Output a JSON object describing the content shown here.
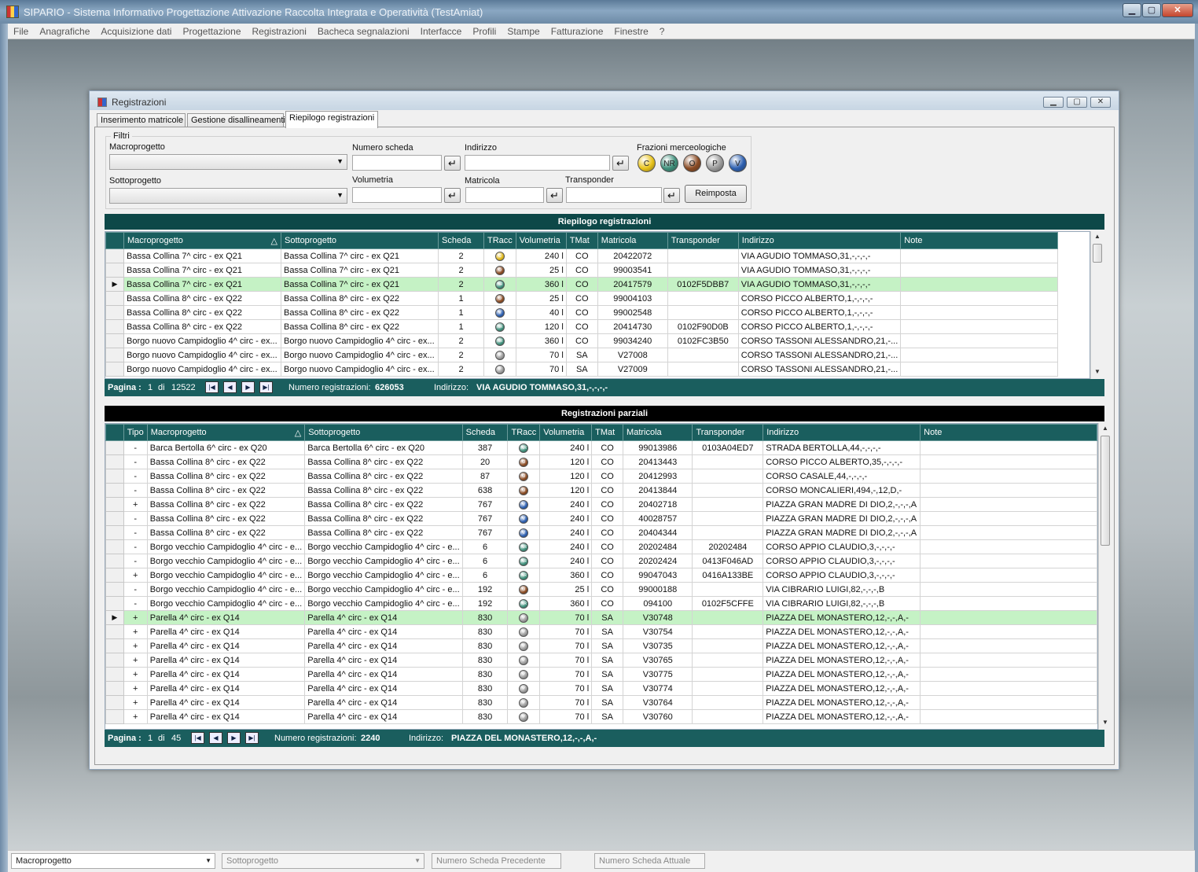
{
  "app": {
    "title": "SIPARIO - Sistema Informativo Progettazione Attivazione Raccolta Integrata e Operatività (TestAmiat)",
    "window_buttons": [
      "▁",
      "▢",
      "✕"
    ]
  },
  "menu": [
    "File",
    "Anagrafiche",
    "Acquisizione dati",
    "Progettazione",
    "Registrazioni",
    "Bacheca segnalazioni",
    "Interfacce",
    "Profili",
    "Stampe",
    "Fatturazione",
    "Finestre",
    "?"
  ],
  "child": {
    "title": "Registrazioni",
    "tabs": [
      "Inserimento matricole",
      "Gestione disallineamenti",
      "Riepilogo registrazioni"
    ],
    "active_tab": 2
  },
  "filters": {
    "legend": "Filtri",
    "macroprogetto_label": "Macroprogetto",
    "sottoprogetto_label": "Sottoprogetto",
    "numero_scheda_label": "Numero scheda",
    "volumetria_label": "Volumetria",
    "indirizzo_label": "Indirizzo",
    "matricola_label": "Matricola",
    "transponder_label": "Transponder",
    "frazioni_label": "Frazioni merceologiche",
    "frazioni": [
      {
        "code": "C",
        "color": "#e8c31a"
      },
      {
        "code": "NR",
        "color": "#3e8f7a"
      },
      {
        "code": "O",
        "color": "#8a4a22"
      },
      {
        "code": "P",
        "color": "#9a9a9a"
      },
      {
        "code": "V",
        "color": "#2c5fb0"
      }
    ],
    "reset_label": "Reimposta",
    "enter_glyph": "↵"
  },
  "frac_colors": {
    "C": "#e0b81a",
    "NR": "#3e8f7a",
    "O": "#8a4a22",
    "P": "#9a9a9a",
    "V": "#2c5fb0"
  },
  "grid1": {
    "title": "Riepilogo registrazioni",
    "title_bg": "#0d4848",
    "columns": [
      "Macroprogetto",
      "Sottoprogetto",
      "Scheda",
      "TRacc",
      "Volumetria",
      "TMat",
      "Matricola",
      "Transponder",
      "Indirizzo",
      "Note"
    ],
    "sort_glyph": "△",
    "rows": [
      {
        "macro": "Bassa Collina 7^ circ - ex Q21",
        "sotto": "Bassa Collina 7^ circ - ex Q21",
        "scheda": "2",
        "tracc": "C",
        "vol": "240 l",
        "tmat": "CO",
        "matricola": "20422072",
        "transponder": "",
        "indirizzo": "VIA AGUDIO TOMMASO,31,-,-,-,-",
        "note": ""
      },
      {
        "macro": "Bassa Collina 7^ circ - ex Q21",
        "sotto": "Bassa Collina 7^ circ - ex Q21",
        "scheda": "2",
        "tracc": "O",
        "vol": "25 l",
        "tmat": "CO",
        "matricola": "99003541",
        "transponder": "",
        "indirizzo": "VIA AGUDIO TOMMASO,31,-,-,-,-",
        "note": ""
      },
      {
        "macro": "Bassa Collina 7^ circ - ex Q21",
        "sotto": "Bassa Collina 7^ circ - ex Q21",
        "scheda": "2",
        "tracc": "NR",
        "vol": "360 l",
        "tmat": "CO",
        "matricola": "20417579",
        "transponder": "0102F5DBB7",
        "indirizzo": "VIA AGUDIO TOMMASO,31,-,-,-,-",
        "note": "",
        "selected": true
      },
      {
        "macro": "Bassa Collina 8^ circ - ex Q22",
        "sotto": "Bassa Collina 8^ circ - ex Q22",
        "scheda": "1",
        "tracc": "O",
        "vol": "25 l",
        "tmat": "CO",
        "matricola": "99004103",
        "transponder": "",
        "indirizzo": "CORSO PICCO ALBERTO,1,-,-,-,-",
        "note": ""
      },
      {
        "macro": "Bassa Collina 8^ circ - ex Q22",
        "sotto": "Bassa Collina 8^ circ - ex Q22",
        "scheda": "1",
        "tracc": "V",
        "vol": "40 l",
        "tmat": "CO",
        "matricola": "99002548",
        "transponder": "",
        "indirizzo": "CORSO PICCO ALBERTO,1,-,-,-,-",
        "note": ""
      },
      {
        "macro": "Bassa Collina 8^ circ - ex Q22",
        "sotto": "Bassa Collina 8^ circ - ex Q22",
        "scheda": "1",
        "tracc": "NR",
        "vol": "120 l",
        "tmat": "CO",
        "matricola": "20414730",
        "transponder": "0102F90D0B",
        "indirizzo": "CORSO PICCO ALBERTO,1,-,-,-,-",
        "note": ""
      },
      {
        "macro": "Borgo nuovo Campidoglio 4^ circ - ex...",
        "sotto": "Borgo nuovo Campidoglio 4^ circ - ex...",
        "scheda": "2",
        "tracc": "NR",
        "vol": "360 l",
        "tmat": "CO",
        "matricola": "99034240",
        "transponder": "0102FC3B50",
        "indirizzo": "CORSO TASSONI ALESSANDRO,21,-...",
        "note": ""
      },
      {
        "macro": "Borgo nuovo Campidoglio 4^ circ - ex...",
        "sotto": "Borgo nuovo Campidoglio 4^ circ - ex...",
        "scheda": "2",
        "tracc": "P",
        "vol": "70 l",
        "tmat": "SA",
        "matricola": "V27008",
        "transponder": "",
        "indirizzo": "CORSO TASSONI ALESSANDRO,21,-...",
        "note": ""
      },
      {
        "macro": "Borgo nuovo Campidoglio 4^ circ - ex...",
        "sotto": "Borgo nuovo Campidoglio 4^ circ - ex...",
        "scheda": "2",
        "tracc": "P",
        "vol": "70 l",
        "tmat": "SA",
        "matricola": "V27009",
        "transponder": "",
        "indirizzo": "CORSO TASSONI ALESSANDRO,21,-...",
        "note": ""
      }
    ],
    "pager": {
      "pagina_label": "Pagina :",
      "page": "1",
      "di": "di",
      "total_pages": "12522",
      "numreg_label": "Numero registrazioni:",
      "numreg": "626053",
      "indirizzo_label": "Indirizzo:",
      "indirizzo": "VIA AGUDIO TOMMASO,31,-,-,-,-"
    }
  },
  "grid2": {
    "title": "Registrazioni parziali",
    "title_bg": "#000000",
    "columns": [
      "Tipo",
      "Macroprogetto",
      "Sottoprogetto",
      "Scheda",
      "TRacc",
      "Volumetria",
      "TMat",
      "Matricola",
      "Transponder",
      "Indirizzo",
      "Note"
    ],
    "sort_glyph": "△",
    "rows": [
      {
        "tipo": "-",
        "macro": "Barca Bertolla 6^ circ - ex Q20",
        "sotto": "Barca Bertolla 6^ circ - ex Q20",
        "scheda": "387",
        "tracc": "NR",
        "vol": "240 l",
        "tmat": "CO",
        "matricola": "99013986",
        "transponder": "0103A04ED7",
        "indirizzo": "STRADA BERTOLLA,44,-,-,-,-",
        "note": ""
      },
      {
        "tipo": "-",
        "macro": "Bassa Collina 8^ circ - ex Q22",
        "sotto": "Bassa Collina 8^ circ - ex Q22",
        "scheda": "20",
        "tracc": "O",
        "vol": "120 l",
        "tmat": "CO",
        "matricola": "20413443",
        "transponder": "",
        "indirizzo": "CORSO PICCO ALBERTO,35,-,-,-,-",
        "note": ""
      },
      {
        "tipo": "-",
        "macro": "Bassa Collina 8^ circ - ex Q22",
        "sotto": "Bassa Collina 8^ circ - ex Q22",
        "scheda": "87",
        "tracc": "O",
        "vol": "120 l",
        "tmat": "CO",
        "matricola": "20412993",
        "transponder": "",
        "indirizzo": "CORSO CASALE,44,-,-,-,-",
        "note": ""
      },
      {
        "tipo": "-",
        "macro": "Bassa Collina 8^ circ - ex Q22",
        "sotto": "Bassa Collina 8^ circ - ex Q22",
        "scheda": "638",
        "tracc": "O",
        "vol": "120 l",
        "tmat": "CO",
        "matricola": "20413844",
        "transponder": "",
        "indirizzo": "CORSO MONCALIERI,494,-,12,D,-",
        "note": ""
      },
      {
        "tipo": "+",
        "macro": "Bassa Collina 8^ circ - ex Q22",
        "sotto": "Bassa Collina 8^ circ - ex Q22",
        "scheda": "767",
        "tracc": "V",
        "vol": "240 l",
        "tmat": "CO",
        "matricola": "20402718",
        "transponder": "",
        "indirizzo": "PIAZZA GRAN MADRE DI DIO,2,-,-,-,A",
        "note": ""
      },
      {
        "tipo": "-",
        "macro": "Bassa Collina 8^ circ - ex Q22",
        "sotto": "Bassa Collina 8^ circ - ex Q22",
        "scheda": "767",
        "tracc": "V",
        "vol": "240 l",
        "tmat": "CO",
        "matricola": "40028757",
        "transponder": "",
        "indirizzo": "PIAZZA GRAN MADRE DI DIO,2,-,-,-,A",
        "note": ""
      },
      {
        "tipo": "-",
        "macro": "Bassa Collina 8^ circ - ex Q22",
        "sotto": "Bassa Collina 8^ circ - ex Q22",
        "scheda": "767",
        "tracc": "V",
        "vol": "240 l",
        "tmat": "CO",
        "matricola": "20404344",
        "transponder": "",
        "indirizzo": "PIAZZA GRAN MADRE DI DIO,2,-,-,-,A",
        "note": ""
      },
      {
        "tipo": "-",
        "macro": "Borgo vecchio Campidoglio 4^ circ - e...",
        "sotto": "Borgo vecchio Campidoglio 4^ circ - e...",
        "scheda": "6",
        "tracc": "NR",
        "vol": "240 l",
        "tmat": "CO",
        "matricola": "20202484",
        "transponder": "20202484",
        "indirizzo": "CORSO APPIO CLAUDIO,3,-,-,-,-",
        "note": ""
      },
      {
        "tipo": "-",
        "macro": "Borgo vecchio Campidoglio 4^ circ - e...",
        "sotto": "Borgo vecchio Campidoglio 4^ circ - e...",
        "scheda": "6",
        "tracc": "NR",
        "vol": "240 l",
        "tmat": "CO",
        "matricola": "20202424",
        "transponder": "0413F046AD",
        "indirizzo": "CORSO APPIO CLAUDIO,3,-,-,-,-",
        "note": ""
      },
      {
        "tipo": "+",
        "macro": "Borgo vecchio Campidoglio 4^ circ - e...",
        "sotto": "Borgo vecchio Campidoglio 4^ circ - e...",
        "scheda": "6",
        "tracc": "NR",
        "vol": "360 l",
        "tmat": "CO",
        "matricola": "99047043",
        "transponder": "0416A133BE",
        "indirizzo": "CORSO APPIO CLAUDIO,3,-,-,-,-",
        "note": ""
      },
      {
        "tipo": "-",
        "macro": "Borgo vecchio Campidoglio 4^ circ - e...",
        "sotto": "Borgo vecchio Campidoglio 4^ circ - e...",
        "scheda": "192",
        "tracc": "O",
        "vol": "25 l",
        "tmat": "CO",
        "matricola": "99000188",
        "transponder": "",
        "indirizzo": "VIA CIBRARIO LUIGI,82,-,-,-,B",
        "note": ""
      },
      {
        "tipo": "-",
        "macro": "Borgo vecchio Campidoglio 4^ circ - e...",
        "sotto": "Borgo vecchio Campidoglio 4^ circ - e...",
        "scheda": "192",
        "tracc": "NR",
        "vol": "360 l",
        "tmat": "CO",
        "matricola": "094100",
        "transponder": "0102F5CFFE",
        "indirizzo": "VIA CIBRARIO LUIGI,82,-,-,-,B",
        "note": ""
      },
      {
        "tipo": "+",
        "macro": "Parella 4^ circ - ex Q14",
        "sotto": "Parella 4^ circ - ex Q14",
        "scheda": "830",
        "tracc": "P",
        "vol": "70 l",
        "tmat": "SA",
        "matricola": "V30748",
        "transponder": "",
        "indirizzo": "PIAZZA DEL MONASTERO,12,-,-,A,-",
        "note": "",
        "selected": true
      },
      {
        "tipo": "+",
        "macro": "Parella 4^ circ - ex Q14",
        "sotto": "Parella 4^ circ - ex Q14",
        "scheda": "830",
        "tracc": "P",
        "vol": "70 l",
        "tmat": "SA",
        "matricola": "V30754",
        "transponder": "",
        "indirizzo": "PIAZZA DEL MONASTERO,12,-,-,A,-",
        "note": ""
      },
      {
        "tipo": "+",
        "macro": "Parella 4^ circ - ex Q14",
        "sotto": "Parella 4^ circ - ex Q14",
        "scheda": "830",
        "tracc": "P",
        "vol": "70 l",
        "tmat": "SA",
        "matricola": "V30735",
        "transponder": "",
        "indirizzo": "PIAZZA DEL MONASTERO,12,-,-,A,-",
        "note": ""
      },
      {
        "tipo": "+",
        "macro": "Parella 4^ circ - ex Q14",
        "sotto": "Parella 4^ circ - ex Q14",
        "scheda": "830",
        "tracc": "P",
        "vol": "70 l",
        "tmat": "SA",
        "matricola": "V30765",
        "transponder": "",
        "indirizzo": "PIAZZA DEL MONASTERO,12,-,-,A,-",
        "note": ""
      },
      {
        "tipo": "+",
        "macro": "Parella 4^ circ - ex Q14",
        "sotto": "Parella 4^ circ - ex Q14",
        "scheda": "830",
        "tracc": "P",
        "vol": "70 l",
        "tmat": "SA",
        "matricola": "V30775",
        "transponder": "",
        "indirizzo": "PIAZZA DEL MONASTERO,12,-,-,A,-",
        "note": ""
      },
      {
        "tipo": "+",
        "macro": "Parella 4^ circ - ex Q14",
        "sotto": "Parella 4^ circ - ex Q14",
        "scheda": "830",
        "tracc": "P",
        "vol": "70 l",
        "tmat": "SA",
        "matricola": "V30774",
        "transponder": "",
        "indirizzo": "PIAZZA DEL MONASTERO,12,-,-,A,-",
        "note": ""
      },
      {
        "tipo": "+",
        "macro": "Parella 4^ circ - ex Q14",
        "sotto": "Parella 4^ circ - ex Q14",
        "scheda": "830",
        "tracc": "P",
        "vol": "70 l",
        "tmat": "SA",
        "matricola": "V30764",
        "transponder": "",
        "indirizzo": "PIAZZA DEL MONASTERO,12,-,-,A,-",
        "note": ""
      },
      {
        "tipo": "+",
        "macro": "Parella 4^ circ - ex Q14",
        "sotto": "Parella 4^ circ - ex Q14",
        "scheda": "830",
        "tracc": "P",
        "vol": "70 l",
        "tmat": "SA",
        "matricola": "V30760",
        "transponder": "",
        "indirizzo": "PIAZZA DEL MONASTERO,12,-,-,A,-",
        "note": ""
      }
    ],
    "pager": {
      "pagina_label": "Pagina :",
      "page": "1",
      "di": "di",
      "total_pages": "45",
      "numreg_label": "Numero registrazioni:",
      "numreg": "2240",
      "indirizzo_label": "Indirizzo:",
      "indirizzo": "PIAZZA DEL MONASTERO,12,-,-,A,-"
    }
  },
  "pager_buttons": [
    "|◀",
    "◀",
    "▶",
    "▶|"
  ],
  "statusbar": {
    "macroprogetto": "Macroprogetto",
    "sottoprogetto": "Sottoprogetto",
    "scheda_prec": "Numero Scheda Precedente",
    "scheda_att": "Numero Scheda Attuale"
  }
}
